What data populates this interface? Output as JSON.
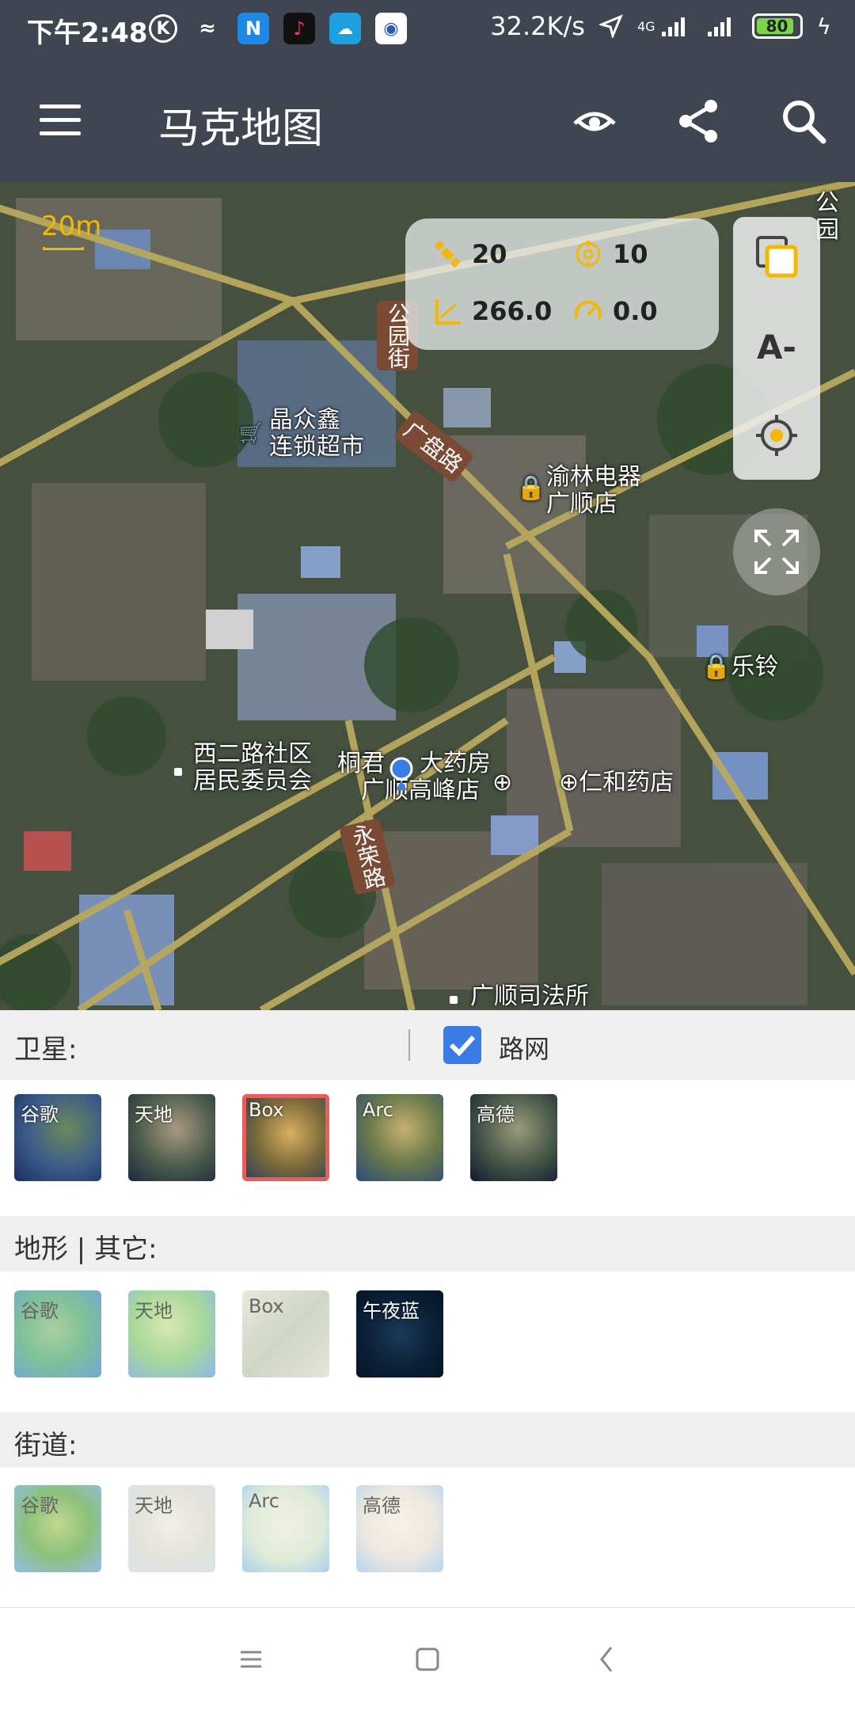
{
  "status_bar": {
    "time": "下午2:48",
    "network_speed": "32.2K/s",
    "network_type": "4G",
    "battery": "80",
    "icons_left": [
      "k-icon",
      "tilde-icon",
      "n-app-icon",
      "tiktok-icon",
      "cloud-app-icon",
      "shield-app-icon"
    ]
  },
  "app_bar": {
    "title": "马克地图",
    "icons": [
      "menu-icon",
      "eye-icon",
      "share-icon",
      "search-icon"
    ]
  },
  "map": {
    "scale_label": "20m",
    "info": {
      "satellites": "20",
      "accuracy": "10",
      "altitude": "266.0",
      "speed": "0.0"
    },
    "side_controls": [
      "layers-icon",
      "font-size-icon",
      "locate-icon"
    ],
    "side_font_label": "A-",
    "labels": {
      "poi1_line1": "晶众鑫",
      "poi1_line2": "连锁超市",
      "poi2_line1": "渝林电器",
      "poi2_line2": "广顺店",
      "poi3": "乐铃",
      "poi4_line1": "西二路社区",
      "poi4_line2": "居民委员会",
      "poi5_line1": "桐君",
      "poi5_line1b": "大药房",
      "poi5_line2": "广顺高峰店",
      "poi6": "仁和药店",
      "poi7": "广顺司法所",
      "road1": "公园街",
      "road2": "广盘路",
      "road3": "永荣路",
      "edge_label": "公园"
    },
    "accent_color": "#f4b800"
  },
  "satellite_section": {
    "title": "卫星:",
    "road_network_label": "路网",
    "road_network_checked": true,
    "tiles": [
      {
        "label": "谷歌"
      },
      {
        "label": "天地"
      },
      {
        "label": "Box",
        "selected": true
      },
      {
        "label": "Arc"
      },
      {
        "label": "高德"
      }
    ]
  },
  "terrain_section": {
    "title": "地形 | 其它:",
    "tiles": [
      {
        "label": "谷歌"
      },
      {
        "label": "天地"
      },
      {
        "label": "Box"
      },
      {
        "label": "午夜蓝"
      }
    ]
  },
  "street_section": {
    "title": "街道:",
    "tiles": [
      {
        "label": "谷歌"
      },
      {
        "label": "天地"
      },
      {
        "label": "Arc"
      },
      {
        "label": "高德"
      }
    ]
  },
  "nav_bar": {
    "buttons": [
      "menu-nav-icon",
      "home-nav-icon",
      "back-nav-icon"
    ]
  }
}
